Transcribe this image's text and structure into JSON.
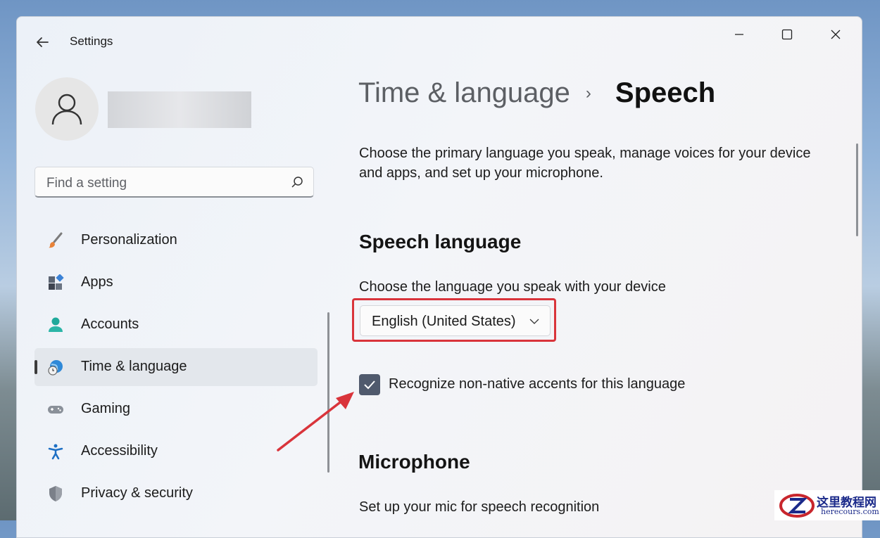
{
  "window": {
    "title": "Settings"
  },
  "search": {
    "placeholder": "Find a setting"
  },
  "nav": {
    "items": [
      {
        "label": "Personalization",
        "icon": "brush-icon"
      },
      {
        "label": "Apps",
        "icon": "apps-icon"
      },
      {
        "label": "Accounts",
        "icon": "accounts-icon"
      },
      {
        "label": "Time & language",
        "icon": "time-language-icon",
        "selected": true
      },
      {
        "label": "Gaming",
        "icon": "gamepad-icon"
      },
      {
        "label": "Accessibility",
        "icon": "accessibility-icon"
      },
      {
        "label": "Privacy & security",
        "icon": "shield-icon"
      }
    ]
  },
  "breadcrumb": {
    "parent": "Time & language",
    "separator": "›",
    "current": "Speech"
  },
  "description": "Choose the primary language you speak, manage voices for your device and apps, and set up your microphone.",
  "speech_language": {
    "heading": "Speech language",
    "label": "Choose the language you speak with your device",
    "selected": "English (United States)",
    "checkbox_label": "Recognize non-native accents for this language",
    "checkbox_checked": true
  },
  "microphone": {
    "heading": "Microphone",
    "label": "Set up your mic for speech recognition"
  },
  "watermark": {
    "title": "这里教程网",
    "url": "herecours.com"
  },
  "colors": {
    "highlight": "#d9343b",
    "checkbox": "#505a6d"
  }
}
